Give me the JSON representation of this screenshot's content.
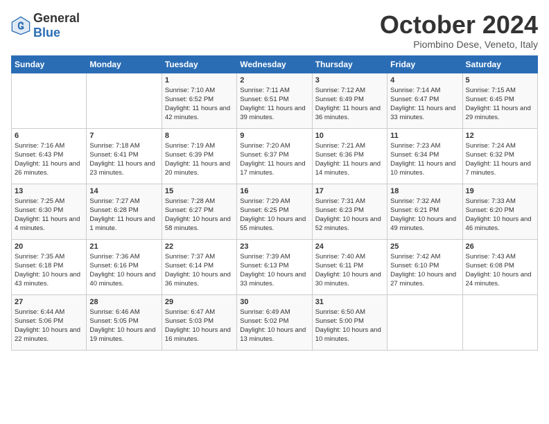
{
  "logo": {
    "general": "General",
    "blue": "Blue"
  },
  "title": "October 2024",
  "location": "Piombino Dese, Veneto, Italy",
  "days_of_week": [
    "Sunday",
    "Monday",
    "Tuesday",
    "Wednesday",
    "Thursday",
    "Friday",
    "Saturday"
  ],
  "weeks": [
    [
      {
        "num": "",
        "info": ""
      },
      {
        "num": "",
        "info": ""
      },
      {
        "num": "1",
        "info": "Sunrise: 7:10 AM\nSunset: 6:52 PM\nDaylight: 11 hours and 42 minutes."
      },
      {
        "num": "2",
        "info": "Sunrise: 7:11 AM\nSunset: 6:51 PM\nDaylight: 11 hours and 39 minutes."
      },
      {
        "num": "3",
        "info": "Sunrise: 7:12 AM\nSunset: 6:49 PM\nDaylight: 11 hours and 36 minutes."
      },
      {
        "num": "4",
        "info": "Sunrise: 7:14 AM\nSunset: 6:47 PM\nDaylight: 11 hours and 33 minutes."
      },
      {
        "num": "5",
        "info": "Sunrise: 7:15 AM\nSunset: 6:45 PM\nDaylight: 11 hours and 29 minutes."
      }
    ],
    [
      {
        "num": "6",
        "info": "Sunrise: 7:16 AM\nSunset: 6:43 PM\nDaylight: 11 hours and 26 minutes."
      },
      {
        "num": "7",
        "info": "Sunrise: 7:18 AM\nSunset: 6:41 PM\nDaylight: 11 hours and 23 minutes."
      },
      {
        "num": "8",
        "info": "Sunrise: 7:19 AM\nSunset: 6:39 PM\nDaylight: 11 hours and 20 minutes."
      },
      {
        "num": "9",
        "info": "Sunrise: 7:20 AM\nSunset: 6:37 PM\nDaylight: 11 hours and 17 minutes."
      },
      {
        "num": "10",
        "info": "Sunrise: 7:21 AM\nSunset: 6:36 PM\nDaylight: 11 hours and 14 minutes."
      },
      {
        "num": "11",
        "info": "Sunrise: 7:23 AM\nSunset: 6:34 PM\nDaylight: 11 hours and 10 minutes."
      },
      {
        "num": "12",
        "info": "Sunrise: 7:24 AM\nSunset: 6:32 PM\nDaylight: 11 hours and 7 minutes."
      }
    ],
    [
      {
        "num": "13",
        "info": "Sunrise: 7:25 AM\nSunset: 6:30 PM\nDaylight: 11 hours and 4 minutes."
      },
      {
        "num": "14",
        "info": "Sunrise: 7:27 AM\nSunset: 6:28 PM\nDaylight: 11 hours and 1 minute."
      },
      {
        "num": "15",
        "info": "Sunrise: 7:28 AM\nSunset: 6:27 PM\nDaylight: 10 hours and 58 minutes."
      },
      {
        "num": "16",
        "info": "Sunrise: 7:29 AM\nSunset: 6:25 PM\nDaylight: 10 hours and 55 minutes."
      },
      {
        "num": "17",
        "info": "Sunrise: 7:31 AM\nSunset: 6:23 PM\nDaylight: 10 hours and 52 minutes."
      },
      {
        "num": "18",
        "info": "Sunrise: 7:32 AM\nSunset: 6:21 PM\nDaylight: 10 hours and 49 minutes."
      },
      {
        "num": "19",
        "info": "Sunrise: 7:33 AM\nSunset: 6:20 PM\nDaylight: 10 hours and 46 minutes."
      }
    ],
    [
      {
        "num": "20",
        "info": "Sunrise: 7:35 AM\nSunset: 6:18 PM\nDaylight: 10 hours and 43 minutes."
      },
      {
        "num": "21",
        "info": "Sunrise: 7:36 AM\nSunset: 6:16 PM\nDaylight: 10 hours and 40 minutes."
      },
      {
        "num": "22",
        "info": "Sunrise: 7:37 AM\nSunset: 6:14 PM\nDaylight: 10 hours and 36 minutes."
      },
      {
        "num": "23",
        "info": "Sunrise: 7:39 AM\nSunset: 6:13 PM\nDaylight: 10 hours and 33 minutes."
      },
      {
        "num": "24",
        "info": "Sunrise: 7:40 AM\nSunset: 6:11 PM\nDaylight: 10 hours and 30 minutes."
      },
      {
        "num": "25",
        "info": "Sunrise: 7:42 AM\nSunset: 6:10 PM\nDaylight: 10 hours and 27 minutes."
      },
      {
        "num": "26",
        "info": "Sunrise: 7:43 AM\nSunset: 6:08 PM\nDaylight: 10 hours and 24 minutes."
      }
    ],
    [
      {
        "num": "27",
        "info": "Sunrise: 6:44 AM\nSunset: 5:06 PM\nDaylight: 10 hours and 22 minutes."
      },
      {
        "num": "28",
        "info": "Sunrise: 6:46 AM\nSunset: 5:05 PM\nDaylight: 10 hours and 19 minutes."
      },
      {
        "num": "29",
        "info": "Sunrise: 6:47 AM\nSunset: 5:03 PM\nDaylight: 10 hours and 16 minutes."
      },
      {
        "num": "30",
        "info": "Sunrise: 6:49 AM\nSunset: 5:02 PM\nDaylight: 10 hours and 13 minutes."
      },
      {
        "num": "31",
        "info": "Sunrise: 6:50 AM\nSunset: 5:00 PM\nDaylight: 10 hours and 10 minutes."
      },
      {
        "num": "",
        "info": ""
      },
      {
        "num": "",
        "info": ""
      }
    ]
  ]
}
